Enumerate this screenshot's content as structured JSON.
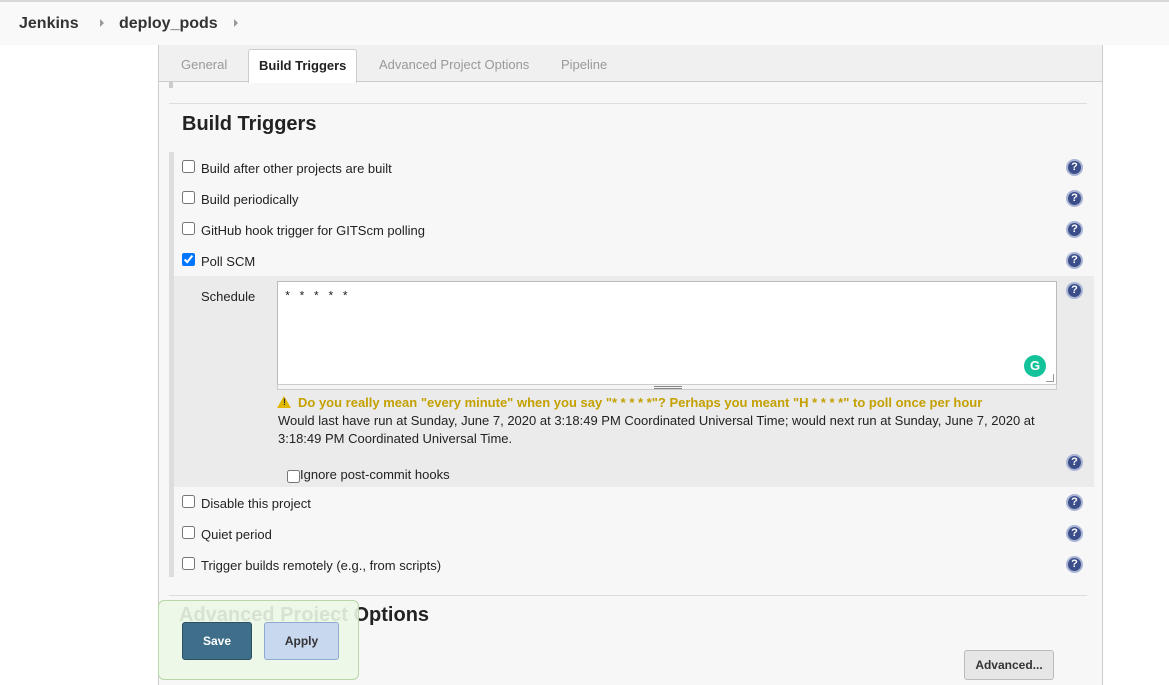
{
  "breadcrumb": {
    "root": "Jenkins",
    "project": "deploy_pods"
  },
  "tabs": [
    {
      "label": "General"
    },
    {
      "label": "Build Triggers"
    },
    {
      "label": "Advanced Project Options"
    },
    {
      "label": "Pipeline"
    }
  ],
  "build_triggers": {
    "title": "Build Triggers",
    "options": [
      {
        "label": "Build after other projects are built",
        "checked": false
      },
      {
        "label": "Build periodically",
        "checked": false
      },
      {
        "label": "GitHub hook trigger for GITScm polling",
        "checked": false
      },
      {
        "label": "Poll SCM",
        "checked": true
      }
    ],
    "schedule": {
      "label": "Schedule",
      "value": "* * * * *",
      "warning": "Do you really mean \"every minute\" when you say \"* * * * *\"? Perhaps you meant \"H * * * *\" to poll once per hour",
      "info": "Would last have run at Sunday, June 7, 2020 at 3:18:49 PM Coordinated Universal Time; would next run at Sunday, June 7, 2020 at 3:18:49 PM Coordinated Universal Time.",
      "ignore_label": "Ignore post-commit hooks",
      "ignore_checked": false
    },
    "more_options": [
      {
        "label": "Disable this project",
        "checked": false
      },
      {
        "label": "Quiet period",
        "checked": false
      },
      {
        "label": "Trigger builds remotely (e.g., from scripts)",
        "checked": false
      }
    ]
  },
  "advanced": {
    "title": "Advanced Project Options",
    "button": "Advanced..."
  },
  "actions": {
    "save": "Save",
    "apply": "Apply"
  },
  "help_icon": "?",
  "grammarly_glyph": "G"
}
